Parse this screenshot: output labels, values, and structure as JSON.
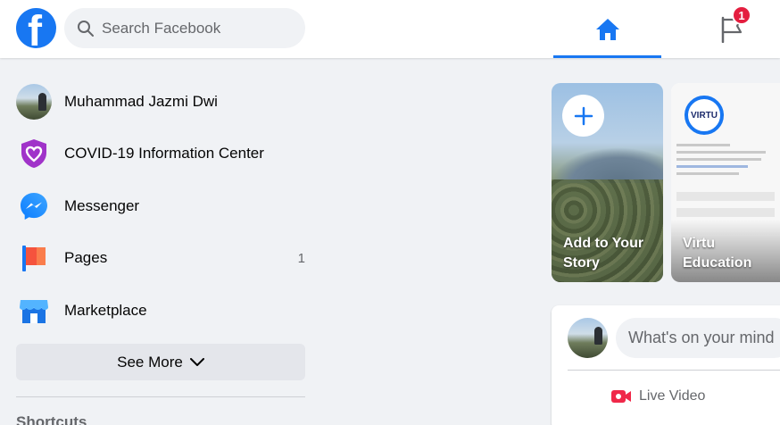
{
  "header": {
    "logo_letter": "f",
    "search_placeholder": "Search Facebook",
    "pages_badge": "1"
  },
  "sidebar": {
    "items": [
      {
        "label": "Muhammad Jazmi Dwi",
        "icon": "avatar"
      },
      {
        "label": "COVID-19 Information Center",
        "icon": "covid-heart-icon"
      },
      {
        "label": "Messenger",
        "icon": "messenger-icon"
      },
      {
        "label": "Pages",
        "icon": "pages-flag-icon",
        "count": "1"
      },
      {
        "label": "Marketplace",
        "icon": "marketplace-icon"
      }
    ],
    "see_more": "See More",
    "shortcuts_title": "Shortcuts"
  },
  "stories": {
    "create_label": "Add to Your Story",
    "items": [
      {
        "name": "Virtu Education",
        "logo_text": "VIRTU"
      }
    ]
  },
  "composer": {
    "placeholder": "What's on your mind",
    "live_video": "Live Video"
  },
  "colors": {
    "brand": "#1877f2",
    "badge": "#e41e3f",
    "live_red": "#f02849"
  }
}
